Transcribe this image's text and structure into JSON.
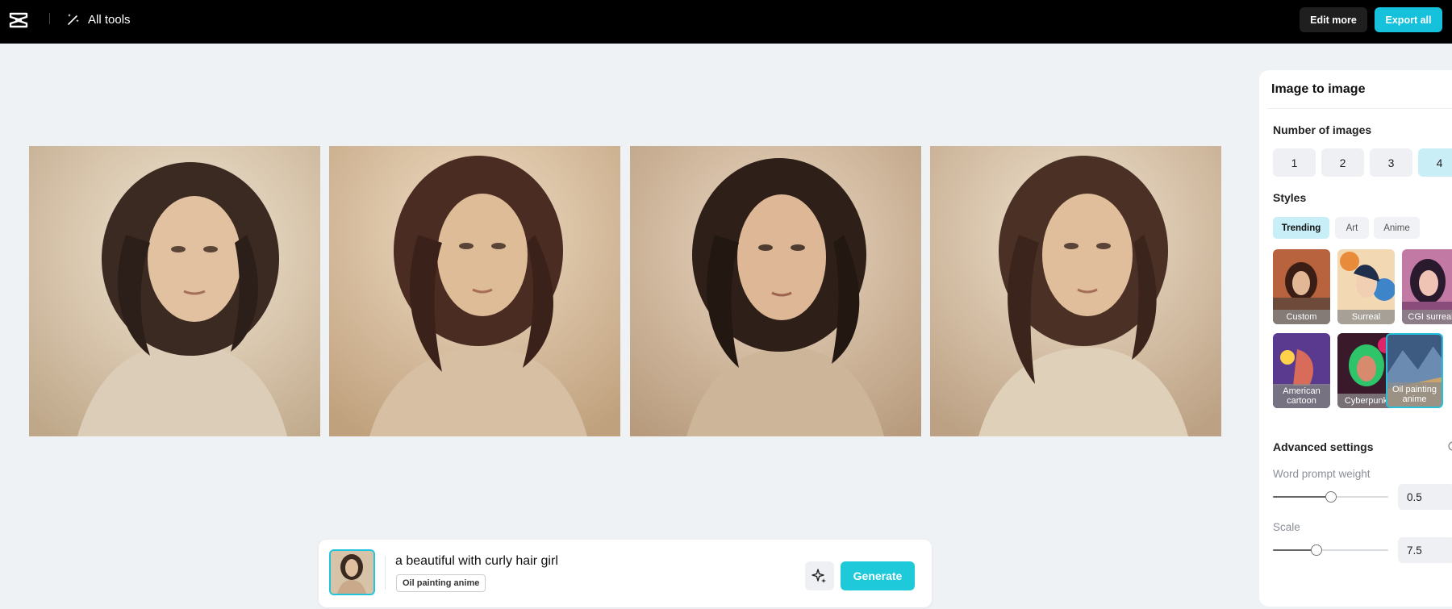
{
  "topbar": {
    "all_tools_label": "All tools",
    "edit_more_label": "Edit more",
    "export_all_label": "Export all",
    "logo_icon": "capcut-logo-icon",
    "tools_icon": "magic-wand-icon"
  },
  "results": {
    "images": [
      {
        "icon": "generated-portrait-1"
      },
      {
        "icon": "generated-portrait-2"
      },
      {
        "icon": "generated-portrait-3"
      },
      {
        "icon": "generated-portrait-4"
      }
    ]
  },
  "prompt": {
    "text": "a beautiful with curly hair girl",
    "style_chip": "Oil painting anime",
    "generate_label": "Generate",
    "magic_icon": "sparkle-icon"
  },
  "panel": {
    "title": "Image to image",
    "number_of_images_label": "Number of images",
    "number_options": [
      "1",
      "2",
      "3",
      "4"
    ],
    "number_selected": "4",
    "styles_label": "Styles",
    "style_tabs": [
      {
        "label": "Trending",
        "active": true
      },
      {
        "label": "Art",
        "active": false
      },
      {
        "label": "Anime",
        "active": false
      }
    ],
    "style_cards": [
      {
        "label": "Custom",
        "selected": false
      },
      {
        "label": "Surreal",
        "selected": false
      },
      {
        "label": "CGI surreal",
        "selected": false
      },
      {
        "label": "American cartoon",
        "selected": false
      },
      {
        "label": "Cyberpunk",
        "selected": false
      },
      {
        "label": "Oil painting anime",
        "selected": true
      }
    ],
    "advanced_settings_label": "Advanced settings",
    "word_prompt_weight_label": "Word prompt weight",
    "word_prompt_weight_value": "0.5",
    "word_prompt_weight_fraction": 0.5,
    "scale_label": "Scale",
    "scale_value": "7.5",
    "scale_fraction": 0.375
  },
  "colors": {
    "accent": "#16c1dc",
    "topbar_bg": "#000000",
    "canvas_bg": "#eff2f5"
  }
}
